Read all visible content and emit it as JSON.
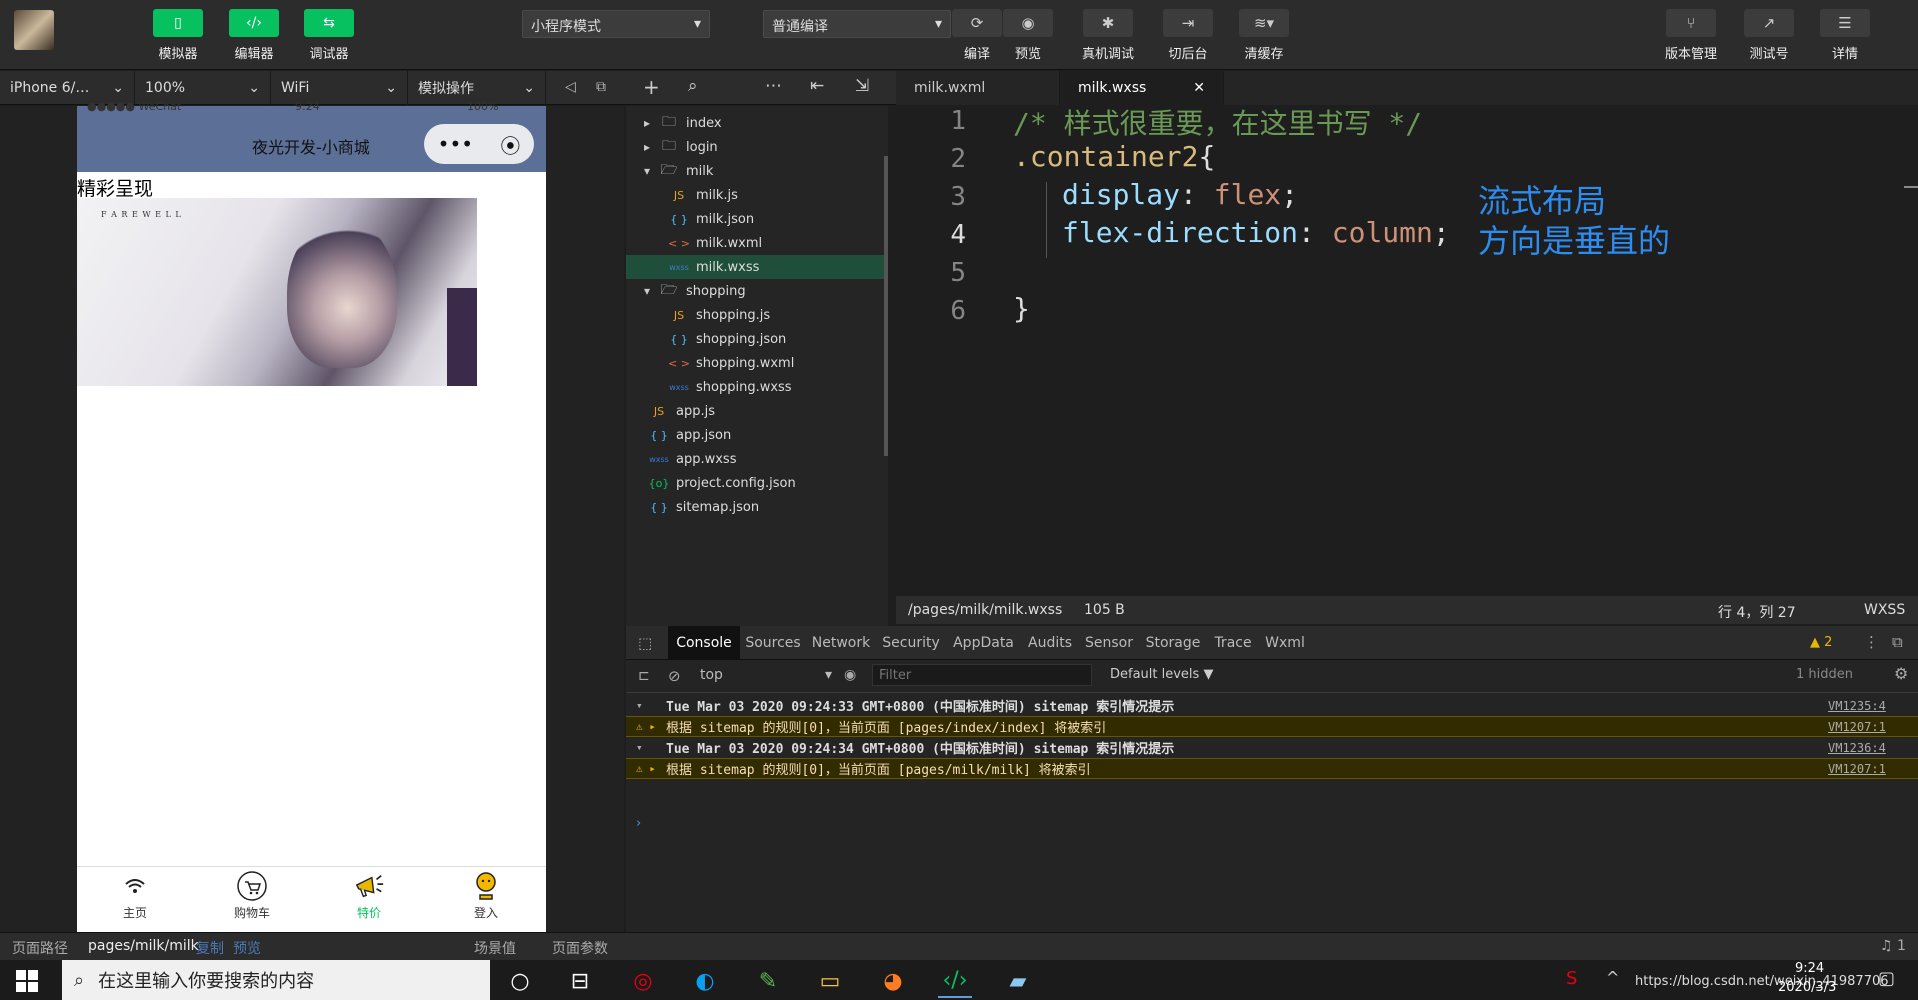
{
  "toolbar": {
    "simulator": "模拟器",
    "editor": "编辑器",
    "debugger": "调试器",
    "mode_select": "小程序模式",
    "compile_select": "普通编译",
    "compile": "编译",
    "preview": "预览",
    "real_debug": "真机调试",
    "background": "切后台",
    "clear_cache": "清缓存",
    "version": "版本管理",
    "test_account": "测试号",
    "details": "详情"
  },
  "bar2": {
    "device": "iPhone 6/…",
    "zoom": "100%",
    "network": "WiFi",
    "simulate_op": "模拟操作"
  },
  "phone": {
    "status_carrier": "●●●●● WeChat",
    "status_time": "9:24",
    "status_battery": "100%",
    "title": "夜光开发-小商城",
    "section_text": "精彩呈现",
    "image_caption": "F A R E W E L L",
    "tabs": [
      "主页",
      "购物车",
      "特价",
      "登入"
    ]
  },
  "explorer": {
    "items": [
      {
        "label": "index",
        "type": "folder",
        "open": false,
        "indent": 0
      },
      {
        "label": "login",
        "type": "folder",
        "open": false,
        "indent": 0
      },
      {
        "label": "milk",
        "type": "folder",
        "open": true,
        "indent": 0
      },
      {
        "label": "milk.js",
        "type": "js",
        "indent": 1
      },
      {
        "label": "milk.json",
        "type": "json",
        "indent": 1
      },
      {
        "label": "milk.wxml",
        "type": "wxml",
        "indent": 1
      },
      {
        "label": "milk.wxss",
        "type": "wxss",
        "indent": 1,
        "selected": true
      },
      {
        "label": "shopping",
        "type": "folder",
        "open": true,
        "indent": 0
      },
      {
        "label": "shopping.js",
        "type": "js",
        "indent": 1
      },
      {
        "label": "shopping.json",
        "type": "json",
        "indent": 1
      },
      {
        "label": "shopping.wxml",
        "type": "wxml",
        "indent": 1
      },
      {
        "label": "shopping.wxss",
        "type": "wxss",
        "indent": 1
      },
      {
        "label": "app.js",
        "type": "js",
        "indent": -1
      },
      {
        "label": "app.json",
        "type": "json",
        "indent": -1
      },
      {
        "label": "app.wxss",
        "type": "wxss",
        "indent": -1
      },
      {
        "label": "project.config.json",
        "type": "config",
        "indent": -1
      },
      {
        "label": "sitemap.json",
        "type": "json",
        "indent": -1
      }
    ]
  },
  "editor": {
    "tabs": [
      "milk.wxml",
      "milk.wxss"
    ],
    "lines": [
      "1",
      "2",
      "3",
      "4",
      "5",
      "6"
    ],
    "comment": "/* 样式很重要，在这里书写 */",
    "selector": ".container2",
    "brace_open": "{",
    "prop1": "display",
    "val1": "flex",
    "prop2": "flex-direction",
    "val2": "column",
    "brace_close": "}",
    "note1": "流式布局",
    "note2": "方向是垂直的"
  },
  "statusbar": {
    "path": "/pages/milk/milk.wxss",
    "size": "105 B",
    "position": "行 4，列 27",
    "lang": "WXSS"
  },
  "devtools": {
    "tabs": [
      "Console",
      "Sources",
      "Network",
      "Security",
      "AppData",
      "Audits",
      "Sensor",
      "Storage",
      "Trace",
      "Wxml"
    ],
    "warn_count": "2",
    "context": "top",
    "filter_placeholder": "Filter",
    "levels": "Default levels ▼",
    "hidden": "1 hidden",
    "logs": [
      {
        "text": "Tue Mar 03 2020 09:24:33 GMT+0800 (中国标准时间) sitemap 索引情况提示",
        "src": "VM1235:4",
        "warn": false
      },
      {
        "text": "根据 sitemap 的规则[0]，当前页面 [pages/index/index] 将被索引",
        "src": "VM1207:1",
        "warn": true
      },
      {
        "text": "Tue Mar 03 2020 09:24:34 GMT+0800 (中国标准时间) sitemap 索引情况提示",
        "src": "VM1236:4",
        "warn": false
      },
      {
        "text": "根据 sitemap 的规则[0]，当前页面 [pages/milk/milk] 将被索引",
        "src": "VM1207:1",
        "warn": true
      }
    ]
  },
  "pagebar": {
    "path_label": "页面路径",
    "path": "pages/milk/milk",
    "copy": "复制",
    "preview": "预览",
    "scene": "场景值",
    "params": "页面参数",
    "notif": "1"
  },
  "taskbar": {
    "search_placeholder": "在这里输入你要搜索的内容",
    "time": "9:24",
    "date": "2020/3/3",
    "watermark": "https://blog.csdn.net/weixin_41987706"
  },
  "colors": {
    "accent": "#07c160",
    "nav": "#5c6f96",
    "selected": "#1f4f3a"
  }
}
